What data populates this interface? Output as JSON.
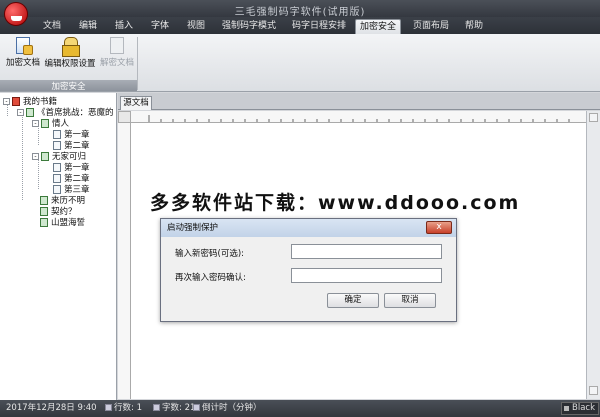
{
  "window": {
    "title": "三毛强制码字软件(试用版)"
  },
  "menu": {
    "tabs": [
      "文档",
      "编辑",
      "插入",
      "字体",
      "视图",
      "强制码字模式",
      "码字日程安排",
      "加密安全",
      "页面布局",
      "帮助"
    ],
    "active_index": 7
  },
  "ribbon": {
    "buttons": [
      {
        "label": "加密文档",
        "icon": "encrypt-document-icon",
        "enabled": true
      },
      {
        "label": "编辑权限设置",
        "icon": "lock-icon",
        "enabled": true
      },
      {
        "label": "解密文档",
        "icon": "decrypt-document-icon",
        "enabled": false
      }
    ],
    "group_label": "加密安全"
  },
  "tree": {
    "root": "我的书籍",
    "book": "《首席挑战：恶魔的",
    "nodes": [
      {
        "label": "情人",
        "children": [
          "第一章",
          "第二章"
        ]
      },
      {
        "label": "无家可归",
        "children": [
          "第一章",
          "第二章",
          "第三章"
        ]
      },
      {
        "label": "来历不明"
      },
      {
        "label": "契约？"
      },
      {
        "label": "山盟海誓"
      }
    ]
  },
  "document": {
    "tab_label": "源文档",
    "watermark": "多多软件站下载：www.ddooo.com"
  },
  "dialog": {
    "title": "启动强制保护",
    "close": "x",
    "new_password_label": "输入新密码(可选):",
    "confirm_password_label": "再次输入密码确认:",
    "ok": "确定",
    "cancel": "取消"
  },
  "status": {
    "datetime": "2017年12月28日 9:40",
    "lines": "行数: 1",
    "chars": "字数: 21",
    "countdown": "倒计时（分钟）",
    "theme": "Black"
  }
}
